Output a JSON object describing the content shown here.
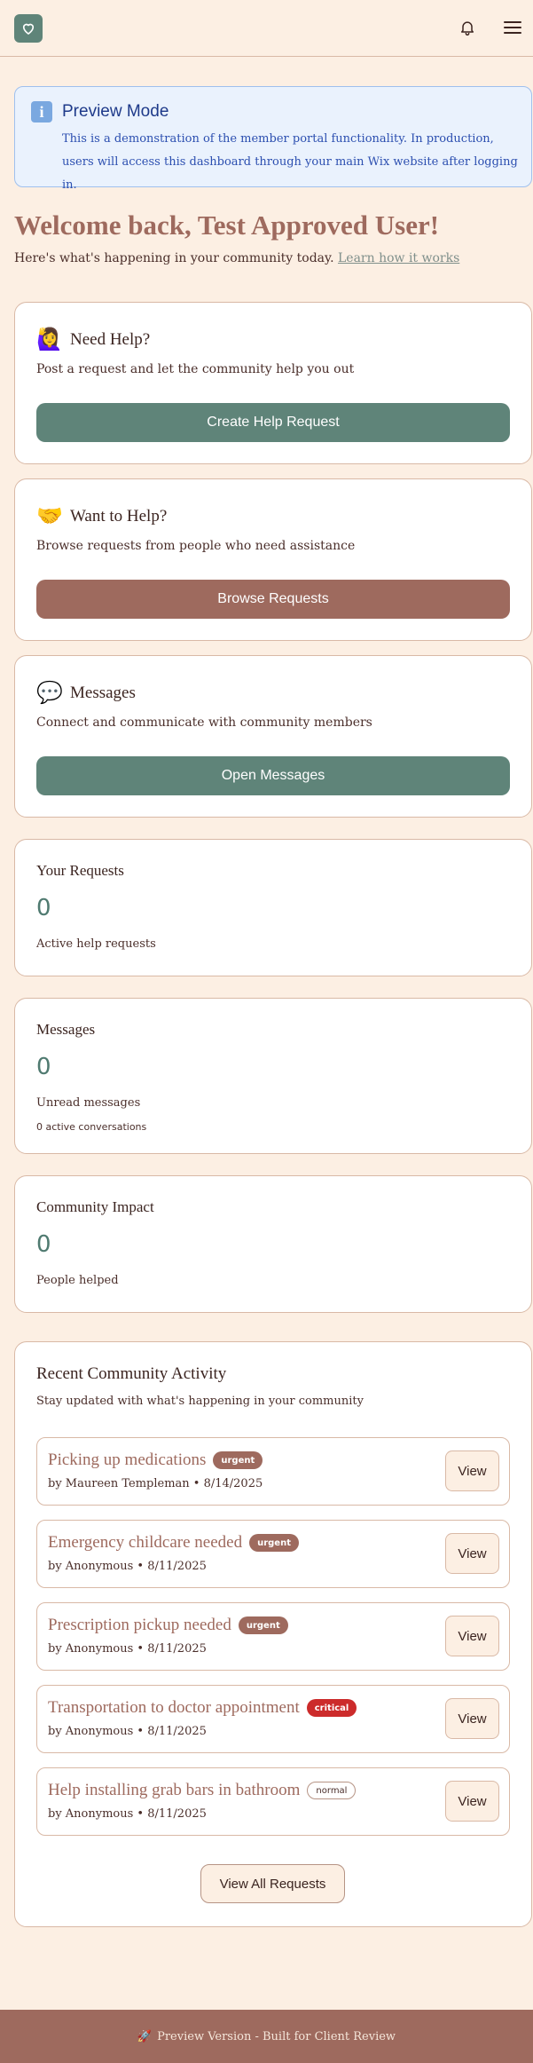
{
  "header": {
    "logo_icon": "heart-icon",
    "bell_icon": "bell-icon",
    "menu_icon": "hamburger-menu-icon"
  },
  "preview": {
    "icon": "info-icon",
    "icon_glyph": "i",
    "title": "Preview Mode",
    "text": "This is a demonstration of the member portal functionality. In production, users will access this dashboard through your main Wix website after logging in."
  },
  "welcome": {
    "title": "Welcome back, Test Approved User!",
    "subtitle": "Here's what's happening in your community today.",
    "link": "Learn how it works"
  },
  "actions": {
    "need_help": {
      "emoji": "🙋‍♀️",
      "title": "Need Help?",
      "desc": "Post a request and let the community help you out",
      "button": "Create Help Request"
    },
    "want_help": {
      "emoji": "🤝",
      "title": "Want to Help?",
      "desc": "Browse requests from people who need assistance",
      "button": "Browse Requests"
    },
    "messages": {
      "emoji": "💬",
      "title": "Messages",
      "desc": "Connect and communicate with community members",
      "button": "Open Messages"
    }
  },
  "stats": {
    "requests": {
      "title": "Your Requests",
      "value": "0",
      "label": "Active help requests"
    },
    "messages": {
      "title": "Messages",
      "value": "0",
      "label": "Unread messages",
      "sub": "0 active conversations"
    },
    "impact": {
      "title": "Community Impact",
      "value": "0",
      "label": "People helped"
    }
  },
  "activity": {
    "title": "Recent Community Activity",
    "desc": "Stay updated with what's happening in your community",
    "view_label": "View",
    "view_all": "View All Requests",
    "items": [
      {
        "title": "Picking up medications",
        "badge": "urgent",
        "meta": "by Maureen Templeman • 8/14/2025"
      },
      {
        "title": "Emergency childcare needed",
        "badge": "urgent",
        "meta": "by Anonymous • 8/11/2025"
      },
      {
        "title": "Prescription pickup needed",
        "badge": "urgent",
        "meta": "by Anonymous • 8/11/2025"
      },
      {
        "title": "Transportation to doctor appointment",
        "badge": "critical",
        "meta": "by Anonymous • 8/11/2025"
      },
      {
        "title": "Help installing grab bars in bathroom",
        "badge": "normal",
        "meta": "by Anonymous • 8/11/2025"
      }
    ]
  },
  "footer": {
    "emoji": "🚀",
    "text": "Preview Version - Built for Client Review"
  },
  "colors": {
    "background": "#fcefe3",
    "primary_green": "#5f8479",
    "primary_brown": "#9e6a5e",
    "critical_red": "#cc2b2b",
    "info_blue": "#1e3a8a"
  }
}
